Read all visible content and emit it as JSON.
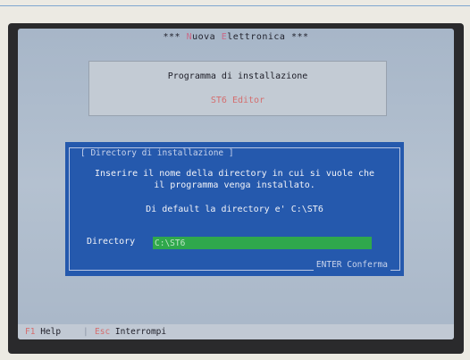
{
  "screen": {
    "title_pre": "*** ",
    "title_accent": "N",
    "title_mid": "uova ",
    "title_accent2": "E",
    "title_post": "lettronica ***"
  },
  "infobox": {
    "line1": "Programma di installazione",
    "line2": "ST6 Editor"
  },
  "dialog": {
    "frame_title": "[ Directory di installazione ]",
    "message_line1": "Inserire il nome della directory in cui si vuole che",
    "message_line2": "il programma venga installato.",
    "default_info": "Di default la directory e'  C:\\ST6",
    "directory_label": "Directory",
    "directory_value": "C:\\ST6",
    "footer_hint": "ENTER Conferma"
  },
  "statusbar": {
    "help_key": "F1",
    "help_label": "Help",
    "separator": "|",
    "quit_key": "Esc",
    "quit_label": "Interrompi"
  },
  "colors": {
    "dialog_bg": "#2559ad",
    "input_bg": "#2fa84c",
    "accent_text": "#d46e6e",
    "screen_bg": "#b4c1d0"
  }
}
